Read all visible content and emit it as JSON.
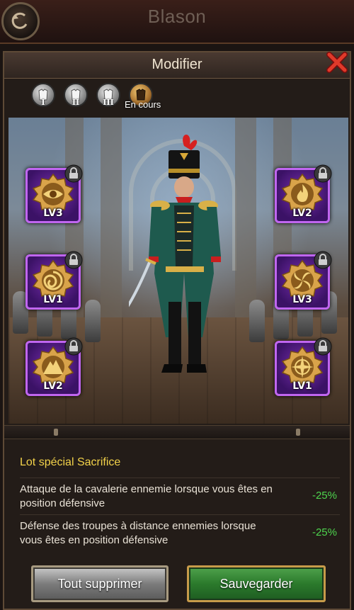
{
  "header": {
    "title": "Blason"
  },
  "dialog": {
    "title": "Modifier",
    "tabs": [
      {
        "numeral": "I"
      },
      {
        "numeral": "II"
      },
      {
        "numeral": "III"
      },
      {
        "numeral": ""
      }
    ],
    "current_tab_label": "En cours",
    "slots_left": [
      {
        "icon": "eye-emblem-icon",
        "level": "LV3",
        "locked": true
      },
      {
        "icon": "swirl-emblem-icon",
        "level": "LV1",
        "locked": true
      },
      {
        "icon": "mountain-emblem-icon",
        "level": "LV2",
        "locked": true
      }
    ],
    "slots_right": [
      {
        "icon": "flame-emblem-icon",
        "level": "LV2",
        "locked": true
      },
      {
        "icon": "vortex-emblem-icon",
        "level": "LV3",
        "locked": true
      },
      {
        "icon": "compass-emblem-icon",
        "level": "LV1",
        "locked": true
      }
    ],
    "info": {
      "title": "Lot spécial Sacrifice",
      "effects": [
        {
          "text": "Attaque de la cavalerie ennemie lorsque vous êtes en position défensive",
          "value": "-25%"
        },
        {
          "text": "Défense des troupes à distance ennemies lorsque vous êtes en position défensive",
          "value": "-25%"
        }
      ]
    },
    "buttons": {
      "delete_all": "Tout supprimer",
      "save": "Sauvegarder"
    }
  },
  "colors": {
    "accent_gold": "#f2d24a",
    "effect_green": "#4ed54e",
    "slot_purple": "#c066f0"
  }
}
